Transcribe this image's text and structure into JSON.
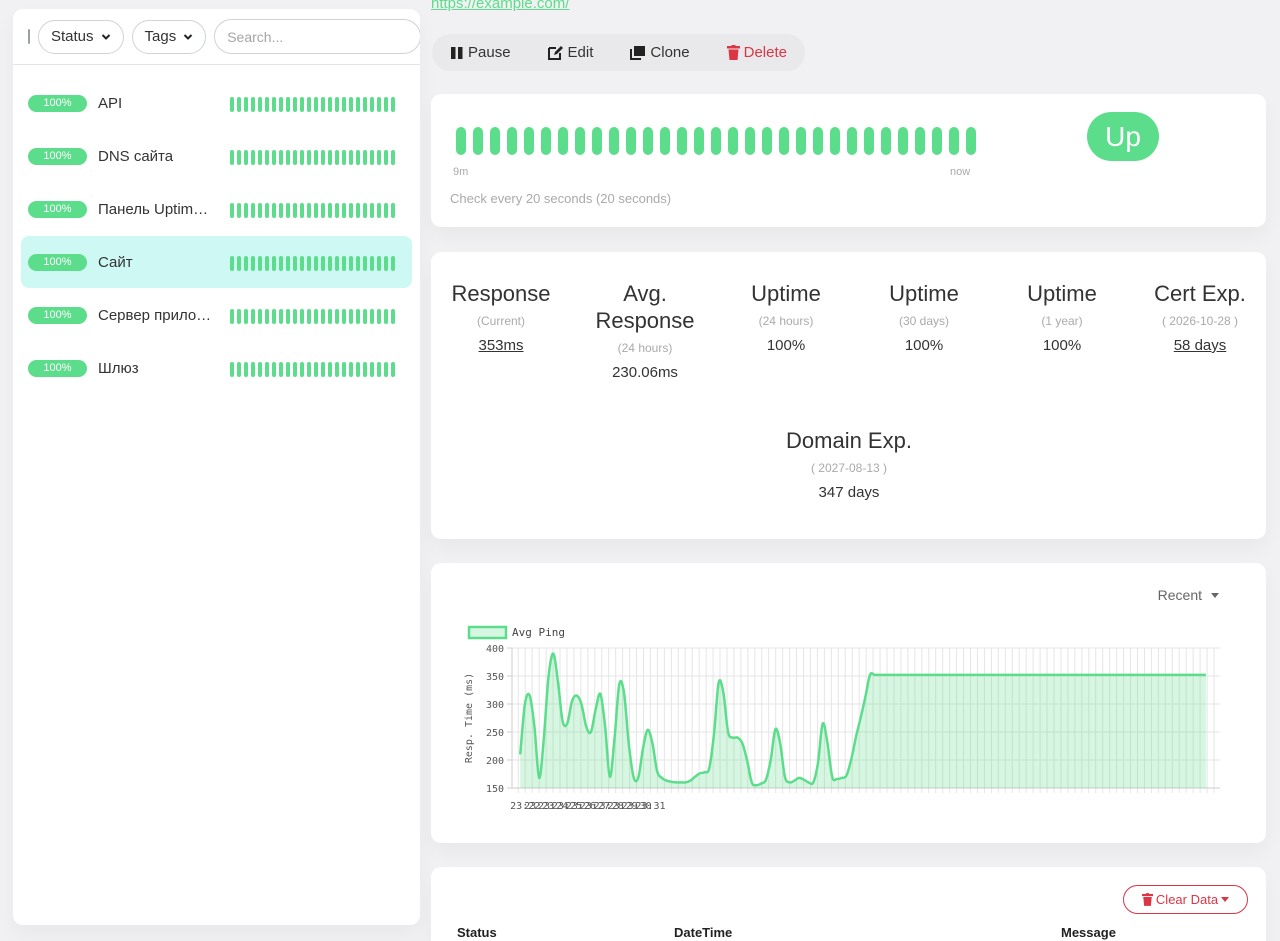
{
  "sidebar": {
    "filters": {
      "status_label": "Status",
      "tags_label": "Tags",
      "search_placeholder": "Search..."
    },
    "monitors": [
      {
        "name": "API",
        "uptime": "100%",
        "beats": 24
      },
      {
        "name": "DNS сайта",
        "uptime": "100%",
        "beats": 24
      },
      {
        "name": "Панель Uptime Kuma",
        "uptime": "100%",
        "beats": 24
      },
      {
        "name": "Сайт",
        "uptime": "100%",
        "beats": 24,
        "active": true
      },
      {
        "name": "Сервер приложений",
        "uptime": "100%",
        "beats": 24
      },
      {
        "name": "Шлюз",
        "uptime": "100%",
        "beats": 24
      }
    ]
  },
  "detail": {
    "url": "https://example.com/",
    "actions": {
      "pause": "Pause",
      "edit": "Edit",
      "clone": "Clone",
      "delete": "Delete"
    },
    "heartbeat": {
      "count": 31,
      "time_start": "9m",
      "time_end": "now",
      "check_interval": "Check every 20 seconds (20 seconds)",
      "status": "Up",
      "status_color": "#5cdd8b"
    },
    "stats": {
      "response": {
        "title": "Response",
        "sub": "(Current)",
        "value": "353ms"
      },
      "avg_response": {
        "title": "Avg. Response",
        "sub": "(24 hours)",
        "value": "230.06ms"
      },
      "uptime_24h": {
        "title": "Uptime",
        "sub": "(24 hours)",
        "value": "100%"
      },
      "uptime_30d": {
        "title": "Uptime",
        "sub": "(30 days)",
        "value": "100%"
      },
      "uptime_1y": {
        "title": "Uptime",
        "sub": "(1 year)",
        "value": "100%"
      },
      "cert_exp": {
        "title": "Cert Exp.",
        "sub": "( 2026-10-28 )",
        "value": "58 days"
      },
      "domain_exp": {
        "title": "Domain Exp.",
        "sub": "( 2027-08-13 )",
        "value": "347 days"
      }
    },
    "period_label": "Recent",
    "events": {
      "clear_label": "Clear Data",
      "col_status": "Status",
      "col_datetime": "DateTime",
      "col_message": "Message"
    }
  },
  "chart_data": {
    "type": "area",
    "ylabel": "Resp. Time (ms)",
    "ylim": [
      150,
      400
    ],
    "yticks": [
      150,
      200,
      250,
      300,
      350,
      400
    ],
    "xticks": [
      "23:22",
      "23:23",
      "23:24",
      "23:25",
      "23:26",
      "23:27",
      "23:28",
      "23:29",
      "23:30",
      "23:31"
    ],
    "xlim_minutes": [
      1341.05,
      1391.93
    ],
    "legend": "top-left",
    "grid": true,
    "color": "#5cdd8b",
    "series": [
      {
        "name": "Avg Ping",
        "x_minutes": [
          1341.64,
          1341.98,
          1342.32,
          1342.66,
          1343.0,
          1343.34,
          1343.68,
          1344.02,
          1344.35,
          1344.68,
          1345.02,
          1345.36,
          1345.7,
          1346.04,
          1346.38,
          1346.72,
          1347.06,
          1347.4,
          1347.74,
          1348.08,
          1348.42,
          1348.76,
          1349.1,
          1349.44,
          1349.78,
          1350.12,
          1350.46,
          1350.8,
          1351.14,
          1351.48,
          1351.82,
          1352.16,
          1352.5,
          1352.84,
          1353.18,
          1353.52,
          1353.86,
          1354.2,
          1354.54,
          1354.88,
          1355.22,
          1355.56,
          1355.9,
          1356.24,
          1356.58,
          1356.92,
          1357.26,
          1357.6,
          1357.94,
          1358.28,
          1358.62,
          1358.96,
          1359.3,
          1359.64,
          1359.98,
          1360.32,
          1360.66,
          1361.0,
          1361.34,
          1361.68,
          1362.02,
          1362.36,
          1362.7,
          1363.04,
          1363.38,
          1363.72,
          1364.06,
          1364.4,
          1364.74,
          1365.08,
          1365.42,
          1365.76,
          1366.1,
          1366.44,
          1366.78,
          1367.12,
          1367.46,
          1367.8,
          1368.14,
          1368.48,
          1368.82,
          1369.16,
          1369.5,
          1369.84,
          1370.18,
          1370.52,
          1370.86,
          1371.2,
          1371.54,
          1371.88,
          1372.22,
          1372.56,
          1372.9,
          1373.24,
          1373.58,
          1373.92,
          1374.26,
          1374.6,
          1374.94,
          1375.28,
          1375.62,
          1375.96,
          1376.3,
          1376.64,
          1376.98,
          1377.32,
          1377.66,
          1378.0,
          1378.34,
          1378.68,
          1379.02,
          1379.36,
          1379.7,
          1380.04,
          1380.38,
          1380.72,
          1381.06,
          1381.4,
          1381.74,
          1382.08,
          1382.42,
          1382.76,
          1383.1,
          1383.44,
          1383.78,
          1384.12,
          1384.46,
          1384.8,
          1385.14,
          1385.48,
          1385.82,
          1386.16,
          1386.5,
          1386.84,
          1387.18,
          1387.52,
          1387.86,
          1388.2,
          1388.54,
          1388.88,
          1389.22,
          1389.56,
          1389.9,
          1390.24,
          1390.58,
          1390.92
        ],
        "values": [
          210,
          300,
          315,
          260,
          168,
          240,
          350,
          390,
          340,
          270,
          265,
          305,
          315,
          300,
          260,
          250,
          290,
          318,
          260,
          170,
          240,
          335,
          320,
          230,
          170,
          168,
          220,
          254,
          230,
          180,
          168,
          163,
          161,
          160,
          160,
          160,
          163,
          170,
          176,
          178,
          185,
          245,
          338,
          320,
          250,
          240,
          240,
          230,
          200,
          160,
          155,
          158,
          165,
          200,
          255,
          230,
          170,
          160,
          163,
          168,
          165,
          160,
          160,
          195,
          265,
          230,
          170,
          166,
          168,
          172,
          200,
          240,
          275,
          312,
          352,
          352,
          352,
          352,
          352,
          352,
          352,
          352,
          352,
          352,
          352,
          352,
          352,
          352,
          352,
          352,
          352,
          352,
          352,
          352,
          352,
          352,
          352,
          352,
          352,
          352,
          352,
          352,
          352,
          352,
          352,
          352,
          352,
          352,
          352,
          352,
          352,
          352,
          352,
          352,
          352,
          352,
          352,
          352,
          352,
          352,
          352,
          352,
          352,
          352,
          352,
          352,
          352,
          352,
          352,
          352,
          352,
          352,
          352,
          352,
          352,
          352,
          352,
          352,
          352,
          352,
          352,
          352,
          352,
          352,
          352,
          352
        ]
      }
    ]
  }
}
